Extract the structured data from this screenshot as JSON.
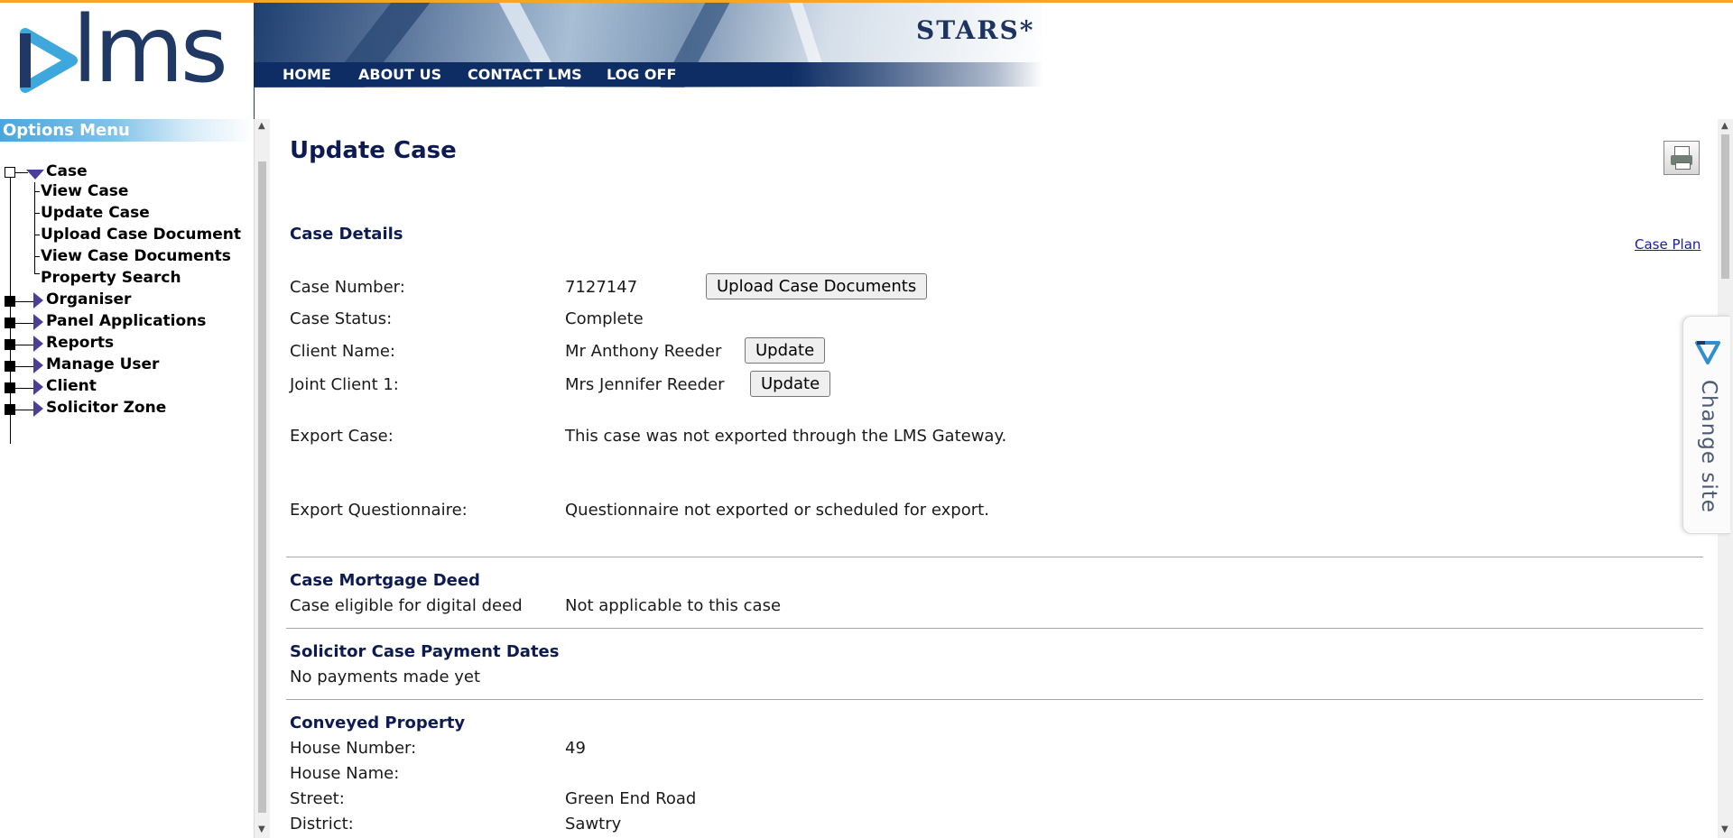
{
  "header": {
    "logo_text": "lms",
    "brand": "STARS*",
    "nav": [
      "HOME",
      "ABOUT US",
      "CONTACT LMS",
      "LOG OFF"
    ]
  },
  "sidebar": {
    "title": "Options Menu",
    "case": {
      "label": "Case",
      "children": [
        "View Case",
        "Update Case",
        "Upload Case Document",
        "View Case Documents",
        "Property Search"
      ]
    },
    "groups": [
      "Organiser",
      "Panel Applications",
      "Reports",
      "Manage User",
      "Client",
      "Solicitor Zone"
    ]
  },
  "main": {
    "title": "Update Case",
    "case_plan_link": "Case Plan",
    "case_details": {
      "heading": "Case Details",
      "case_number_label": "Case Number:",
      "case_number": "7127147",
      "upload_button": "Upload Case Documents",
      "case_status_label": "Case Status:",
      "case_status": "Complete",
      "client_name_label": "Client Name:",
      "client_name": "Mr Anthony Reeder",
      "client_update": "Update",
      "joint_client_label": "Joint Client 1:",
      "joint_client": "Mrs Jennifer Reeder",
      "joint_update": "Update",
      "export_case_label": "Export Case:",
      "export_case": "This case was not exported through the LMS Gateway.",
      "export_q_label": "Export Questionnaire:",
      "export_q": "Questionnaire not exported or scheduled for export."
    },
    "mortgage_deed": {
      "heading": "Case Mortgage Deed",
      "label": "Case eligible for digital deed",
      "value": "Not applicable to this case"
    },
    "payment_dates": {
      "heading": "Solicitor Case Payment Dates",
      "value": "No payments made yet"
    },
    "conveyed_property": {
      "heading": "Conveyed Property",
      "house_number_label": "House Number:",
      "house_number": "49",
      "house_name_label": "House Name:",
      "house_name": "",
      "street_label": "Street:",
      "street": "Green End Road",
      "district_label": "District:",
      "district": "Sawtry"
    }
  },
  "change_site": "Change site",
  "colors": {
    "accent_line": "#f5a623",
    "nav_bg": "#0d2d64",
    "heading": "#0d1b52",
    "logo_text": "#1f3864",
    "logo_mark": "#3ea8dc"
  }
}
